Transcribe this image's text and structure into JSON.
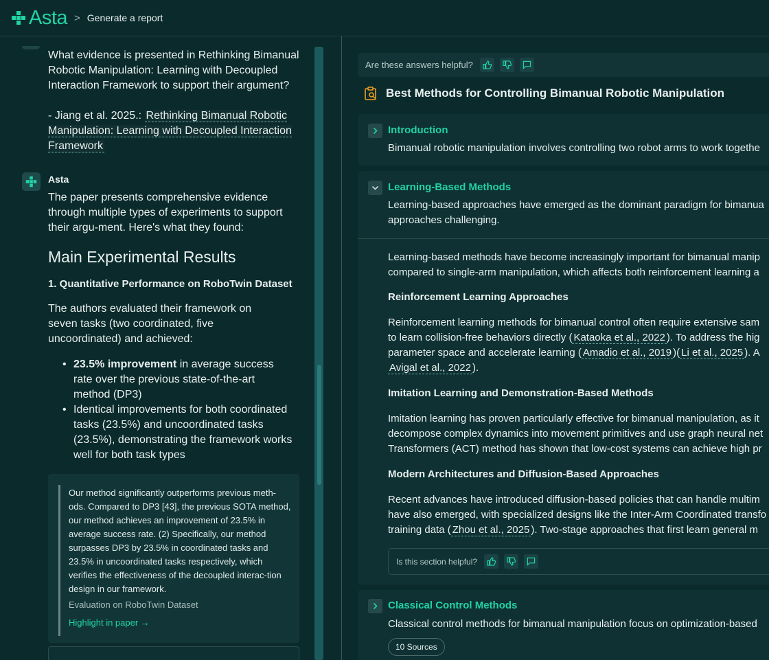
{
  "header": {
    "app_name": "Asta",
    "breadcrumb_separator": ">",
    "breadcrumb": "Generate a report"
  },
  "chat": {
    "user_question": "What evidence is presented in Rethinking Bimanual Robotic Manipulation: Learning with Decoupled Interaction Framework to support their argument?",
    "ref_prefix": "- Jiang et al. 2025.:",
    "ref_link": "Rethinking Bimanual Robotic Manipulation: Learning with Decoupled Interaction Framework",
    "assistant_name": "Asta",
    "intro": "The paper presents comprehensive evidence through multiple types of experiments to support their argu-ment. Here's what they found:",
    "heading": "Main Experimental Results",
    "subheading": "1. Quantitative Performance on RoboTwin Dataset",
    "paragraph": "The authors evaluated their framework on seven tasks (two coordinated, five uncoordinated) and achieved:",
    "bullet1_bold": "23.5% improvement",
    "bullet1_rest": " in average success rate over the previous state-of-the-art method (DP3)",
    "bullet2": "Identical improvements for both coordinated tasks (23.5%) and uncoordinated tasks (23.5%), demonstrating the framework works well for both task types",
    "quote": "Our method significantly outperforms previous meth-ods. Compared to DP3 [43], the previous SOTA method, our method achieves an improvement of 23.5% in average success rate. (2) Specifically, our method surpasses DP3 by 23.5% in coordinated tasks and 23.5% in uncoordinated tasks respectively, which verifies the effectiveness of the decoupled interac-tion design in our framework.",
    "quote_source": "Evaluation on RoboTwin Dataset",
    "highlight_link": "Highlight in paper →"
  },
  "report": {
    "feedback_label": "Are these answers helpful?",
    "title": "Best Methods for Controlling Bimanual Robotic Manipulation",
    "sections": {
      "intro": {
        "title": "Introduction",
        "summary": "Bimanual robotic manipulation involves controlling two robot arms to work togethe"
      },
      "learning": {
        "title": "Learning-Based Methods",
        "summary1": "Learning-based approaches have emerged as the dominant paradigm for bimanua",
        "summary2": "approaches challenging.",
        "p1_line1": "Learning-based methods have become increasingly important for bimanual manip",
        "p1_line2": "compared to single-arm manipulation, which affects both reinforcement learning a",
        "h_rl": "Reinforcement Learning Approaches",
        "rl_line1": "Reinforcement learning methods for bimanual control often require extensive sam",
        "rl_line2_pre": "to learn collision-free behaviors directly (",
        "rl_cite1": "Kataoka et al., 2022",
        "rl_line2_post": "). To address the hig",
        "rl_line3_pre": "parameter space and accelerate learning (",
        "rl_cite2": "Amadio et al., 2019",
        "rl_mid": ")(",
        "rl_cite3": "Li et al., 2025",
        "rl_line3_post": "). A",
        "rl_cite4": "Avigal et al., 2022",
        "rl_line4_post": ").",
        "h_il": "Imitation Learning and Demonstration-Based Methods",
        "il_line1": "Imitation learning has proven particularly effective for bimanual manipulation, as it",
        "il_line2": "decompose complex dynamics into movement primitives and use graph neural net",
        "il_line3": "Transformers (ACT) method has shown that low-cost systems can achieve high pr",
        "h_mod": "Modern Architectures and Diffusion-Based Approaches",
        "mod_line1": "Recent advances have introduced diffusion-based policies that can handle multim",
        "mod_line2": "have also emerged, with specialized designs like the Inter-Arm Coordinated transfo",
        "mod_line3_pre": "training data (",
        "mod_cite": "Zhou et al., 2025",
        "mod_line3_post": "). Two-stage approaches that first learn general m",
        "section_feedback": "Is this section helpful?"
      },
      "classical": {
        "title": "Classical Control Methods",
        "summary": "Classical control methods for bimanual manipulation focus on optimization-based",
        "sources": "10 Sources"
      }
    }
  },
  "colors": {
    "background": "#0b2a2c",
    "accent": "#22d3a4",
    "panel": "#0f3133"
  }
}
